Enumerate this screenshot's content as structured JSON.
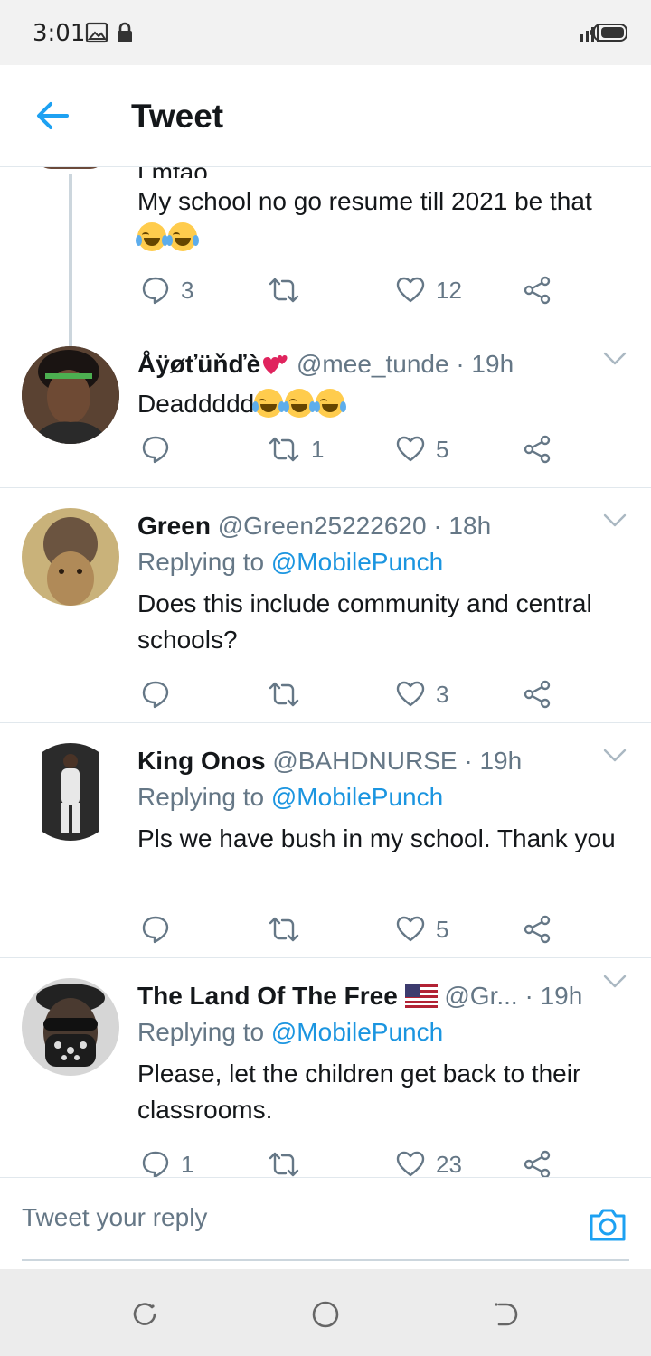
{
  "status_bar": {
    "time": "3:01",
    "icons": [
      "image-icon",
      "lock-icon",
      "signal-icon",
      "battery-icon"
    ]
  },
  "header": {
    "back_icon": "arrow-left-icon",
    "title": "Tweet"
  },
  "thread_top": {
    "text_partial": "Lmfao.....",
    "text": "My school no go resume till 2021 be that",
    "reply_count": "3",
    "retweet_count": "",
    "like_count": "12"
  },
  "replies": [
    {
      "name": "Åÿøťüňďè",
      "handle": "@mee_tunde",
      "time": "· 19h",
      "replying_label": "",
      "replying_to": "",
      "text": "Deaddddd",
      "reply_count": "",
      "retweet_count": "1",
      "like_count": "5"
    },
    {
      "name": "Green",
      "handle": "@Green25222620",
      "time": "· 18h",
      "replying_label": "Replying to",
      "replying_to": "@MobilePunch",
      "text": "Does this include community and central schools?",
      "reply_count": "",
      "retweet_count": "",
      "like_count": "3"
    },
    {
      "name": "King Onos",
      "handle": "@BAHDNURSE",
      "time": "· 19h",
      "replying_label": "Replying to",
      "replying_to": "@MobilePunch",
      "text": "Pls we have bush in my school. Thank you",
      "reply_count": "",
      "retweet_count": "",
      "like_count": "5"
    },
    {
      "name": "The Land Of The Free",
      "handle": "@Gr...",
      "time": "· 19h",
      "replying_label": "Replying to",
      "replying_to": "@MobilePunch",
      "text": "Please, let the children get back to their classrooms.",
      "reply_count": "1",
      "retweet_count": "",
      "like_count": "23"
    }
  ],
  "composer": {
    "placeholder": "Tweet your reply",
    "camera_icon": "camera-icon"
  },
  "nav": [
    "recents-icon",
    "home-icon",
    "back-icon"
  ],
  "colors": {
    "accent": "#1da1f2",
    "link": "#1b95e0",
    "secondary_text": "#657786",
    "heart_emoji": "#e0245e"
  }
}
